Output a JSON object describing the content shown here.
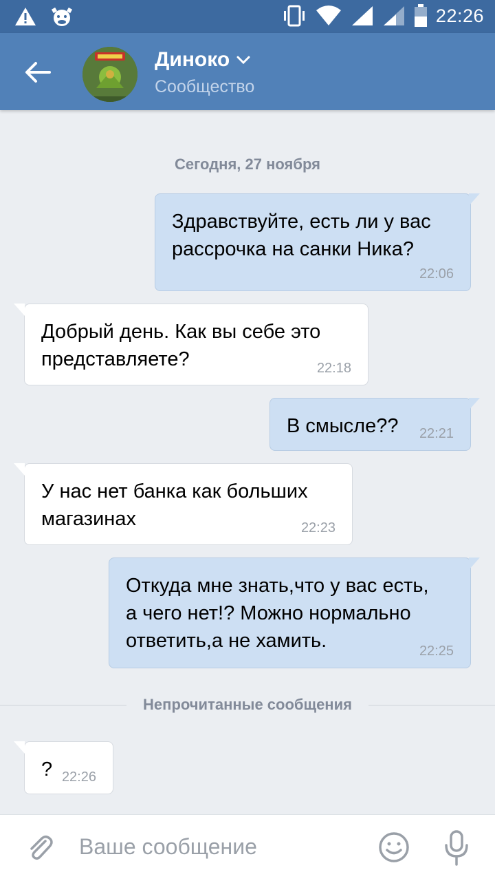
{
  "status_bar": {
    "time": "22:26"
  },
  "header": {
    "title": "Диноко",
    "subtitle": "Сообщество"
  },
  "chat": {
    "date_label": "Сегодня, 27 ноября",
    "messages": [
      {
        "direction": "out",
        "lines": [
          "Здравствуйте, есть ли у вас",
          "рассрочка на санки Ника?"
        ],
        "time": "22:06"
      },
      {
        "direction": "in",
        "lines": [
          "Добрый день. Как вы себе это",
          "представляете?"
        ],
        "time": "22:18"
      },
      {
        "direction": "out",
        "lines": [
          "В смысле??"
        ],
        "time": "22:21"
      },
      {
        "direction": "in",
        "lines": [
          "У нас нет банка как больших",
          "магазинах"
        ],
        "time": "22:23"
      },
      {
        "direction": "out",
        "lines": [
          "Откуда мне знать,что у вас есть,",
          "а чего нет!? Можно нормально",
          "ответить,а не хамить."
        ],
        "time": "22:25"
      },
      {
        "direction": "in",
        "lines": [
          "?"
        ],
        "time": "22:26"
      }
    ],
    "unread_divider": "Непрочитанные сообщения"
  },
  "composer": {
    "placeholder": "Ваше сообщение"
  },
  "colors": {
    "status_bar": "#3d6aa0",
    "app_bar": "#5181b8",
    "outgoing_bubble": "#cddff3",
    "incoming_bubble": "#ffffff",
    "background": "#ebeef2"
  },
  "icons": [
    "warning-icon",
    "cow-app-icon",
    "vibrate-icon",
    "wifi-icon",
    "signal-icon",
    "battery-icon",
    "back-arrow-icon",
    "chevron-down-icon",
    "attach-icon",
    "smile-icon",
    "microphone-icon"
  ]
}
